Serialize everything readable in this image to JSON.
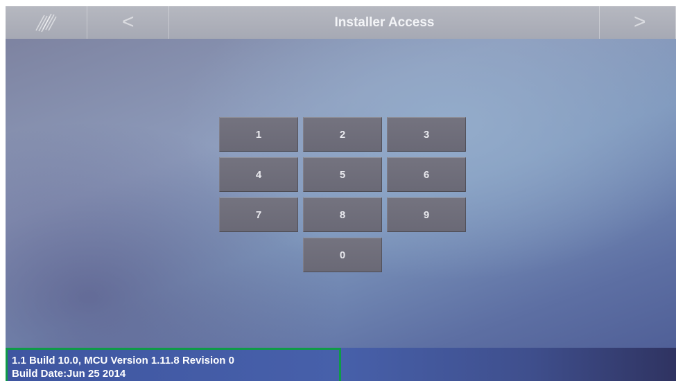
{
  "header": {
    "title": "Installer Access",
    "back_icon": "chevron-left-icon",
    "back_glyph": "<",
    "forward_icon": "chevron-right-icon",
    "forward_glyph": ">",
    "logo_icon": "brand-logo-icon"
  },
  "keypad": {
    "keys": [
      "1",
      "2",
      "3",
      "4",
      "5",
      "6",
      "7",
      "8",
      "9",
      "0"
    ]
  },
  "footer": {
    "version_line": "1.1 Build 10.0, MCU Version 1.11.8 Revision 0",
    "build_date_line": "Build Date:Jun 25 2014",
    "highlight_color": "#0e9b47"
  },
  "colors": {
    "topbar": "#a6a9b4",
    "key": "#6e6d7a",
    "footer": "#4760aa"
  }
}
